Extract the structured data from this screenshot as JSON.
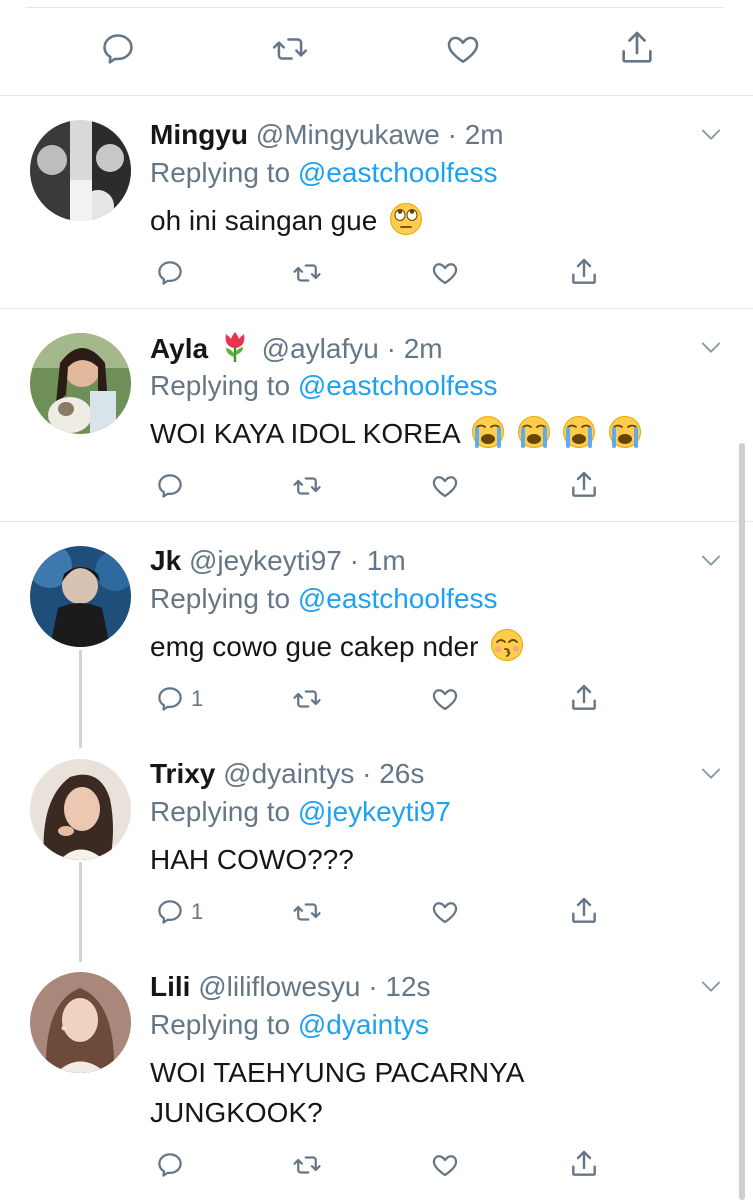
{
  "top_actions": {
    "icons": [
      "reply-icon",
      "retweet-icon",
      "like-icon",
      "share-icon"
    ]
  },
  "tweets": [
    {
      "name": "Mingyu",
      "handle": "@Mingyukawe",
      "separator": "·",
      "time": "2m",
      "replying_prefix": "Replying to",
      "replying_to": "@eastchoolfess",
      "text": "oh ini saingan gue",
      "emoji": [
        "face-with-rolling-eyes"
      ],
      "reply_count": ""
    },
    {
      "name": "Ayla",
      "name_emoji": "tulip",
      "handle": "@aylafyu",
      "separator": "·",
      "time": "2m",
      "replying_prefix": "Replying to",
      "replying_to": "@eastchoolfess",
      "text": "WOI KAYA IDOL KOREA",
      "emoji": [
        "loudly-crying-face",
        "loudly-crying-face",
        "loudly-crying-face",
        "loudly-crying-face"
      ],
      "reply_count": ""
    },
    {
      "name": "Jk",
      "handle": "@jeykeyti97",
      "separator": "·",
      "time": "1m",
      "replying_prefix": "Replying to",
      "replying_to": "@eastchoolfess",
      "text": "emg cowo gue cakep nder",
      "emoji": [
        "kissing-face-with-closed-eyes"
      ],
      "reply_count": "1"
    },
    {
      "name": "Trixy",
      "handle": "@dyaintys",
      "separator": "·",
      "time": "26s",
      "replying_prefix": "Replying to",
      "replying_to": "@jeykeyti97",
      "text": "HAH COWO???",
      "emoji": [],
      "reply_count": "1"
    },
    {
      "name": "Lili",
      "handle": "@liliflowesyu",
      "separator": "·",
      "time": "12s",
      "replying_prefix": "Replying to",
      "replying_to": "@dyaintys",
      "text": "WOI TAEHYUNG PACARNYA JUNGKOOK?",
      "emoji": [],
      "reply_count": ""
    }
  ],
  "colors": {
    "link": "#1da1f2",
    "secondary_text": "#657786",
    "primary_text": "#14171a",
    "divider": "#e1e8ed",
    "thread_line": "#ccd6dd"
  }
}
